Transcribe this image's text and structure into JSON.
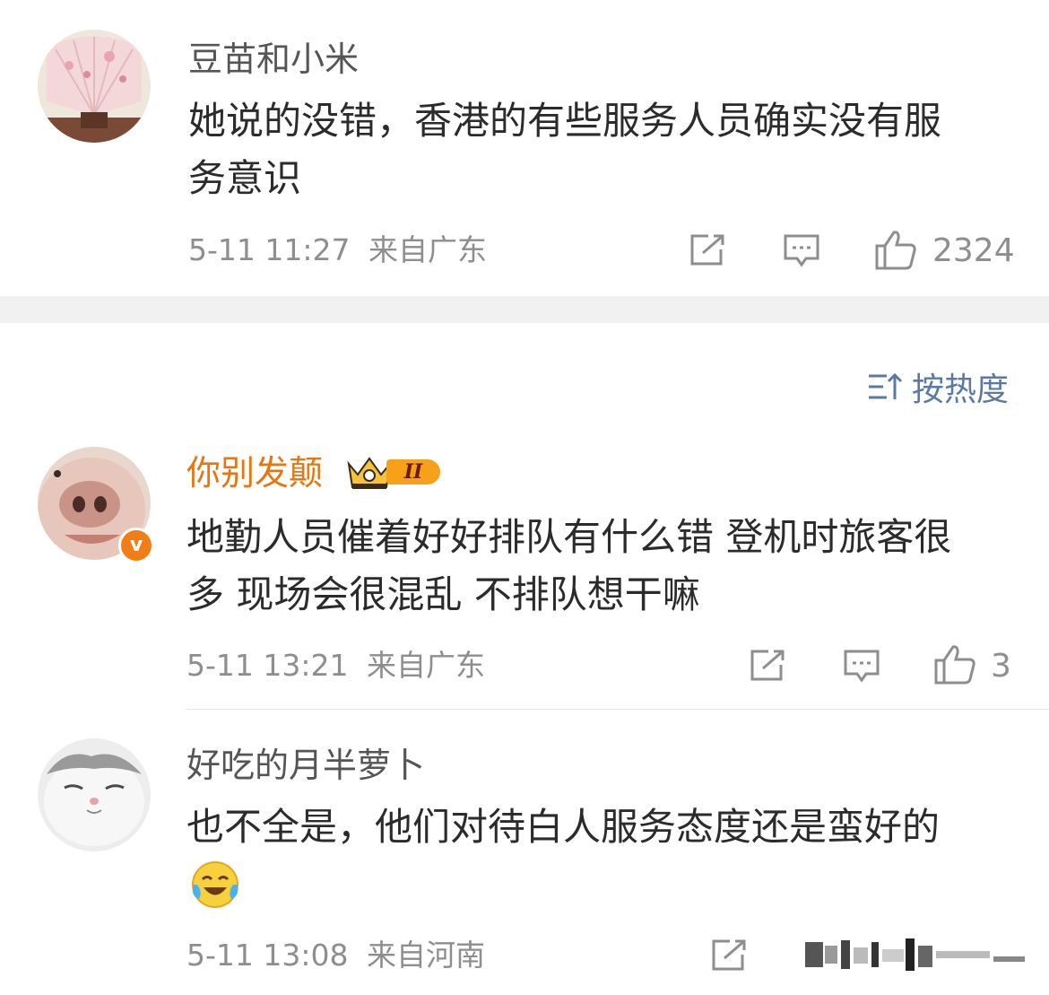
{
  "comments": [
    {
      "username": "豆苗和小米",
      "content_line1": "她说的没错，香港的有些服务人员确实没有服",
      "content_line2": "务意识",
      "time": "5-11 11:27",
      "location": "来自广东",
      "likes": "2324"
    },
    {
      "username": "你别发颠",
      "level_badge": "II",
      "verified_badge": "v",
      "content_line1": "地勤人员催着好好排队有什么错  登机时旅客很",
      "content_line2": "多 现场会很混乱 不排队想干嘛",
      "time": "5-11 13:21",
      "location": "来自广东",
      "likes": "3"
    },
    {
      "username": "好吃的月半萝卜",
      "content_line1": "也不全是，他们对待白人服务态度还是蛮好的",
      "emoji": "crying-laughing-emoji",
      "time": "5-11 13:08",
      "location": "来自河南"
    }
  ],
  "sort": {
    "label": "按热度",
    "icon": "sort-icon"
  },
  "icons": {
    "share": "share-icon",
    "comment": "comment-icon",
    "like": "thumbs-up-icon"
  },
  "colors": {
    "vip_name": "#e8750f",
    "sort_link": "#5a7aa6",
    "meta_text": "#8e8e8e",
    "section_gap": "#f1f1f1"
  }
}
